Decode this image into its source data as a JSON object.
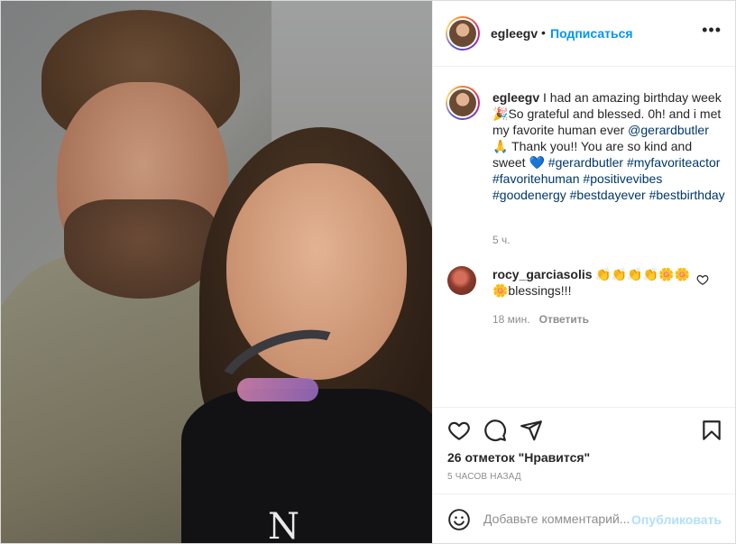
{
  "post": {
    "author": {
      "username": "egleegv",
      "separator": "•",
      "follow_label": "Подписаться",
      "more_label": "•••"
    },
    "caption": {
      "username": "egleegv",
      "text_1": " I had an amazing birthday week ",
      "emoji_1": "🎉",
      "text_2": "So grateful and blessed. 0h! and i met my favorite human ever ",
      "mention": "@gerardbutler",
      "emoji_2": " 🙏 ",
      "text_3": "Thank you!! You are so kind and sweet ",
      "emoji_3": "💙",
      "hashtags": [
        "#gerardbutler",
        "#myfavoriteactor",
        "#favoritehuman",
        "#positivevibes",
        "#goodenergy",
        "#bestdayever",
        "#bestbirthday"
      ],
      "time": "5 ч."
    },
    "comments": [
      {
        "username": "rocy_garciasolis",
        "text": " 👏👏👏👏🌼🌼🌼blessings!!!",
        "time": "18 мин.",
        "reply_label": "Ответить"
      }
    ],
    "likes_text": "26 отметок \"Нравится\"",
    "time_ago": "5 часов назад",
    "comment_input": {
      "placeholder": "Добавьте комментарий...",
      "value": ""
    },
    "publish_label": "Опубликовать",
    "photo": {
      "shirt_text": "N"
    }
  },
  "icons": {
    "like": "heart-outline-icon",
    "comment": "speech-bubble-icon",
    "share": "paper-plane-icon",
    "save": "bookmark-icon",
    "emoji": "smiley-icon"
  },
  "colors": {
    "link": "#00376b",
    "accent": "#0095f6",
    "muted": "#8e8e8e",
    "publish_disabled": "#b2dffc"
  }
}
